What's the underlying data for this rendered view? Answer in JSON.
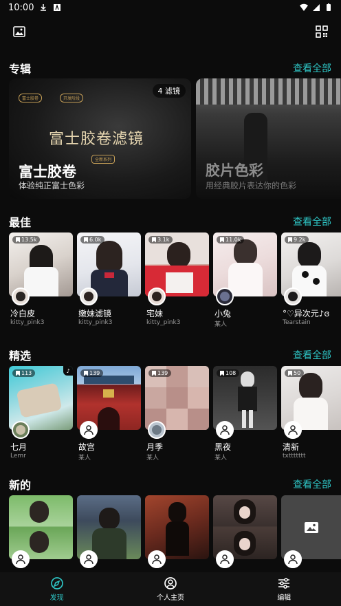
{
  "status_bar": {
    "time": "10:00"
  },
  "sections": {
    "albums": {
      "title": "专辑",
      "view_all": "查看全部"
    },
    "best": {
      "title": "最佳",
      "view_all": "查看全部"
    },
    "featured": {
      "title": "精选",
      "view_all": "查看全部"
    },
    "new": {
      "title": "新的",
      "view_all": "查看全部"
    }
  },
  "albums": [
    {
      "title": "富士胶卷",
      "subtitle": "体验纯正富士色彩",
      "badge": "4 滤镜",
      "overlay_text": "富士胶卷滤镜",
      "tag_left": "富士胶卷",
      "tag_right": "开发阶段",
      "tag_series": "全新系列"
    },
    {
      "title": "胶片色彩",
      "subtitle": "用经典胶片表达你的色彩"
    }
  ],
  "best": [
    {
      "name": "冷白皮",
      "author": "kitty_pink3",
      "count": "13.5k"
    },
    {
      "name": "嫩妹滤镜",
      "author": "kitty_pink3",
      "count": "6.0k"
    },
    {
      "name": "宅妹",
      "author": "kitty_pink3",
      "count": "3.1k"
    },
    {
      "name": "小兔",
      "author": "某人",
      "count": "11.0k"
    },
    {
      "name": "°♡异次元♪ɞ",
      "author": "Tearstain",
      "count": "9.2k"
    }
  ],
  "featured": [
    {
      "name": "七月",
      "author": "Lemr",
      "count": "113"
    },
    {
      "name": "故宫",
      "author": "某人",
      "count": "139"
    },
    {
      "name": "月季",
      "author": "某人",
      "count": "139"
    },
    {
      "name": "黑夜",
      "author": "某人",
      "count": "108"
    },
    {
      "name": "清新",
      "author": "txttttttt",
      "count": "50"
    }
  ],
  "nav": {
    "discover": "发现",
    "profile": "个人主页",
    "edit": "编辑"
  },
  "colors": {
    "accent": "#2ec4c4",
    "background": "#0c0c0c"
  }
}
